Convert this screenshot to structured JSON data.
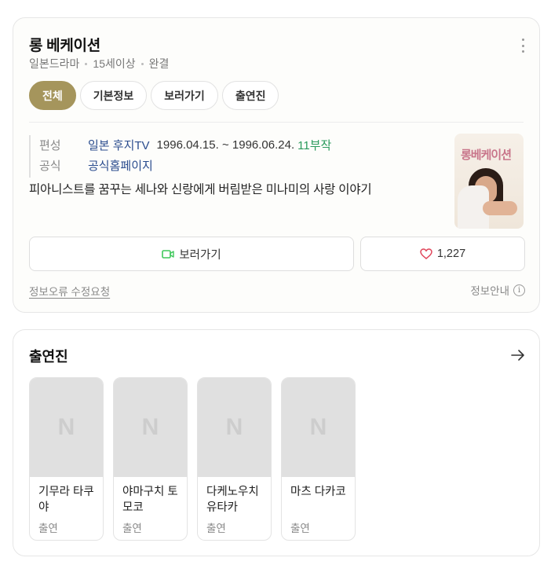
{
  "title": "롱 베케이션",
  "meta": [
    "일본드라마",
    "15세이상",
    "완결"
  ],
  "tabs": [
    "전체",
    "기본정보",
    "보러가기",
    "출연진"
  ],
  "info": {
    "broadcast_label": "편성",
    "broadcaster": "일본 후지TV",
    "dates": "1996.04.15. ~ 1996.06.24.",
    "episodes": "11부작",
    "official_label": "공식",
    "official_link": "공식홈페이지"
  },
  "description": "피아니스트를 꿈꾸는 세나와 신랑에게 버림받은 미나미의 사랑 이야기",
  "poster_text": "롱베케이션",
  "buttons": {
    "watch": "보러가기",
    "likes": "1,227"
  },
  "footer": {
    "report": "정보오류 수정요청",
    "notice": "정보안내",
    "info_glyph": "i"
  },
  "cast_section": {
    "title": "출연진",
    "members": [
      {
        "name": "기무라 타쿠야",
        "role": "출연"
      },
      {
        "name": "야마구치 토모코",
        "role": "출연"
      },
      {
        "name": "다케노우치 유타카",
        "role": "출연"
      },
      {
        "name": "마츠 다카코",
        "role": "출연"
      }
    ],
    "placeholder": "N"
  },
  "colors": {
    "accent": "#a5955c",
    "link": "#2a4c8e",
    "green": "#2a9a5c",
    "heart": "#e0455a",
    "watch_icon": "#3ec85a"
  }
}
